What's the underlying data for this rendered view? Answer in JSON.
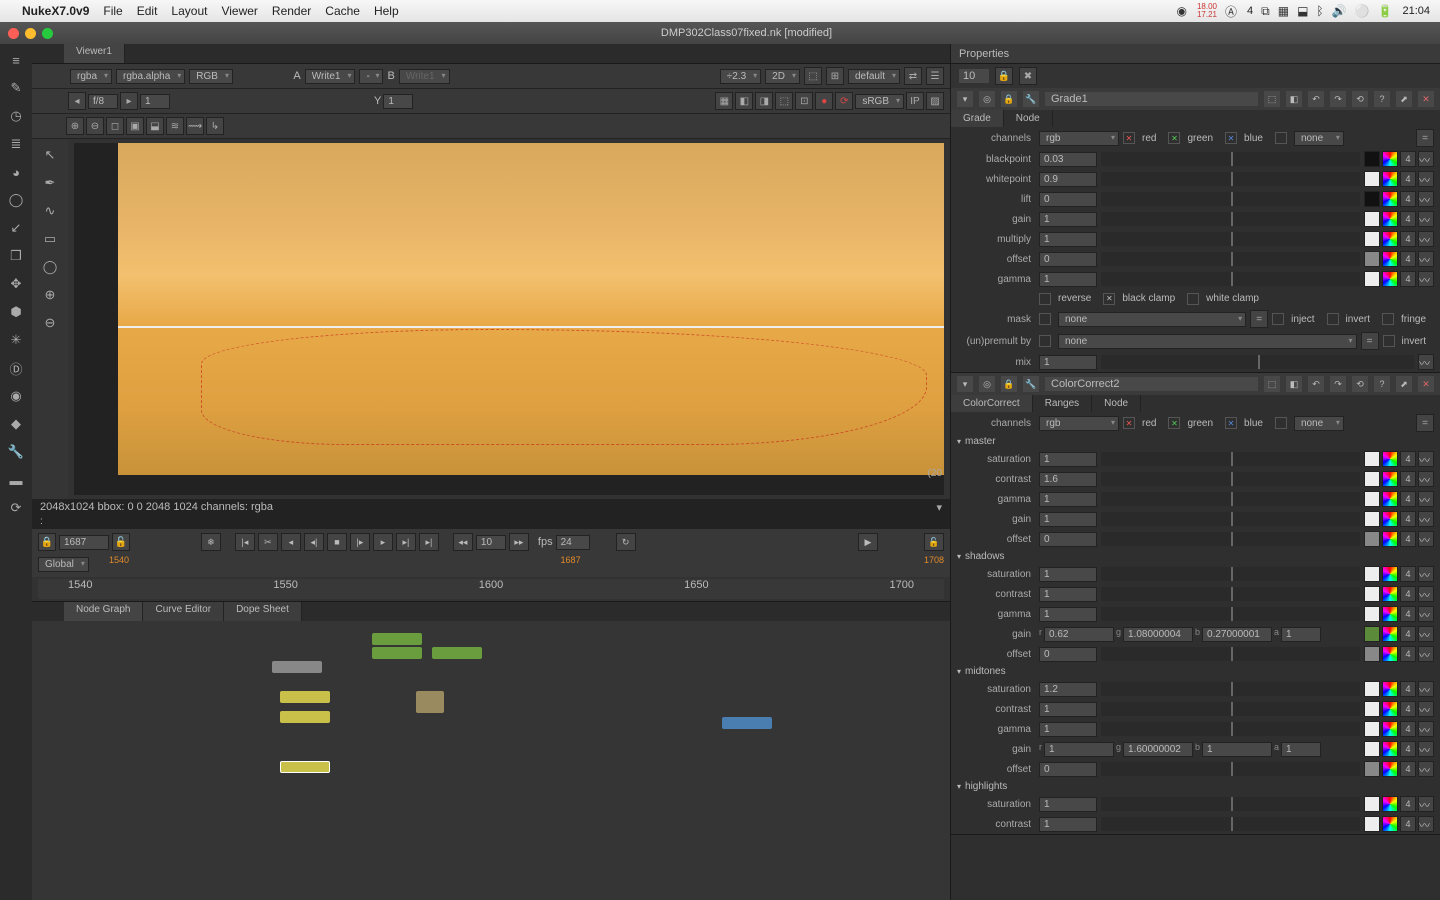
{
  "menubar": {
    "app": "NukeX7.0v9",
    "items": [
      "File",
      "Edit",
      "Layout",
      "Viewer",
      "Render",
      "Cache",
      "Help"
    ],
    "clock": "21:04",
    "stats": "18.00\n17.21"
  },
  "window": {
    "title": "DMP302Class07fixed.nk [modified]"
  },
  "viewer": {
    "tab": "Viewer1",
    "channels": {
      "rgba": "rgba",
      "alpha": "rgba.alpha",
      "mode": "RGB"
    },
    "writeA": "Write1",
    "writeB": "Write1",
    "AB_A": "A",
    "AB_B": "B",
    "dash": "-",
    "zoom": "÷2.3",
    "dim": "2D",
    "default": "default",
    "fstop_label": "f/8",
    "fstop_val": "1",
    "y_label": "Y",
    "y_val": "1",
    "srgb": "sRGB",
    "ip": "IP",
    "info": "2048x1024 bbox: 0 0 2048 1024 channels: rgba",
    "dim_pixels": "(20"
  },
  "transport": {
    "frame": "1687",
    "fps_val": "10",
    "fps_label": "fps",
    "fps": "24",
    "global": "Global",
    "range_start": "1540",
    "range_end": "1708",
    "ticks": [
      "1540",
      "1550",
      "1600",
      "1650",
      "1700"
    ]
  },
  "bottom_tabs": [
    "Node Graph",
    "Curve Editor",
    "Dope Sheet"
  ],
  "properties": {
    "title": "Properties",
    "count": "10",
    "panels": [
      {
        "name": "Grade1",
        "tabs": [
          "Grade",
          "Node"
        ],
        "channels": {
          "sel": "rgb",
          "red": "red",
          "green": "green",
          "blue": "blue",
          "none": "none"
        },
        "rows": [
          {
            "label": "blackpoint",
            "val": "0.03"
          },
          {
            "label": "whitepoint",
            "val": "0.9"
          },
          {
            "label": "lift",
            "val": "0"
          },
          {
            "label": "gain",
            "val": "1"
          },
          {
            "label": "multiply",
            "val": "1"
          },
          {
            "label": "offset",
            "val": "0"
          },
          {
            "label": "gamma",
            "val": "1"
          }
        ],
        "clamp": {
          "reverse": "reverse",
          "black": "black clamp",
          "white": "white clamp"
        },
        "mask": {
          "label": "mask",
          "sel": "none",
          "inject": "inject",
          "invert": "invert",
          "fringe": "fringe"
        },
        "premult": {
          "label": "(un)premult by",
          "sel": "none",
          "invert": "invert"
        },
        "mix": {
          "label": "mix",
          "val": "1"
        }
      },
      {
        "name": "ColorCorrect2",
        "tabs": [
          "ColorCorrect",
          "Ranges",
          "Node"
        ],
        "channels": {
          "sel": "rgb",
          "red": "red",
          "green": "green",
          "blue": "blue",
          "none": "none"
        },
        "sections": {
          "master": {
            "title": "master",
            "rows": [
              {
                "label": "saturation",
                "val": "1"
              },
              {
                "label": "contrast",
                "val": "1.6"
              },
              {
                "label": "gamma",
                "val": "1"
              },
              {
                "label": "gain",
                "val": "1"
              },
              {
                "label": "offset",
                "val": "0"
              }
            ]
          },
          "shadows": {
            "title": "shadows",
            "rows": [
              {
                "label": "saturation",
                "val": "1"
              },
              {
                "label": "contrast",
                "val": "1"
              },
              {
                "label": "gamma",
                "val": "1"
              }
            ],
            "gain": {
              "label": "gain",
              "r": "0.62",
              "g": "1.08000004",
              "b": "0.27000001",
              "a": "1"
            },
            "offset": {
              "label": "offset",
              "val": "0"
            }
          },
          "midtones": {
            "title": "midtones",
            "rows": [
              {
                "label": "saturation",
                "val": "1.2"
              },
              {
                "label": "contrast",
                "val": "1"
              },
              {
                "label": "gamma",
                "val": "1"
              }
            ],
            "gain": {
              "label": "gain",
              "r": "1",
              "g": "1.60000002",
              "b": "1",
              "a": "1"
            },
            "offset": {
              "label": "offset",
              "val": "0"
            }
          },
          "highlights": {
            "title": "highlights",
            "rows": [
              {
                "label": "saturation",
                "val": "1"
              },
              {
                "label": "contrast",
                "val": "1"
              }
            ]
          }
        }
      }
    ]
  }
}
